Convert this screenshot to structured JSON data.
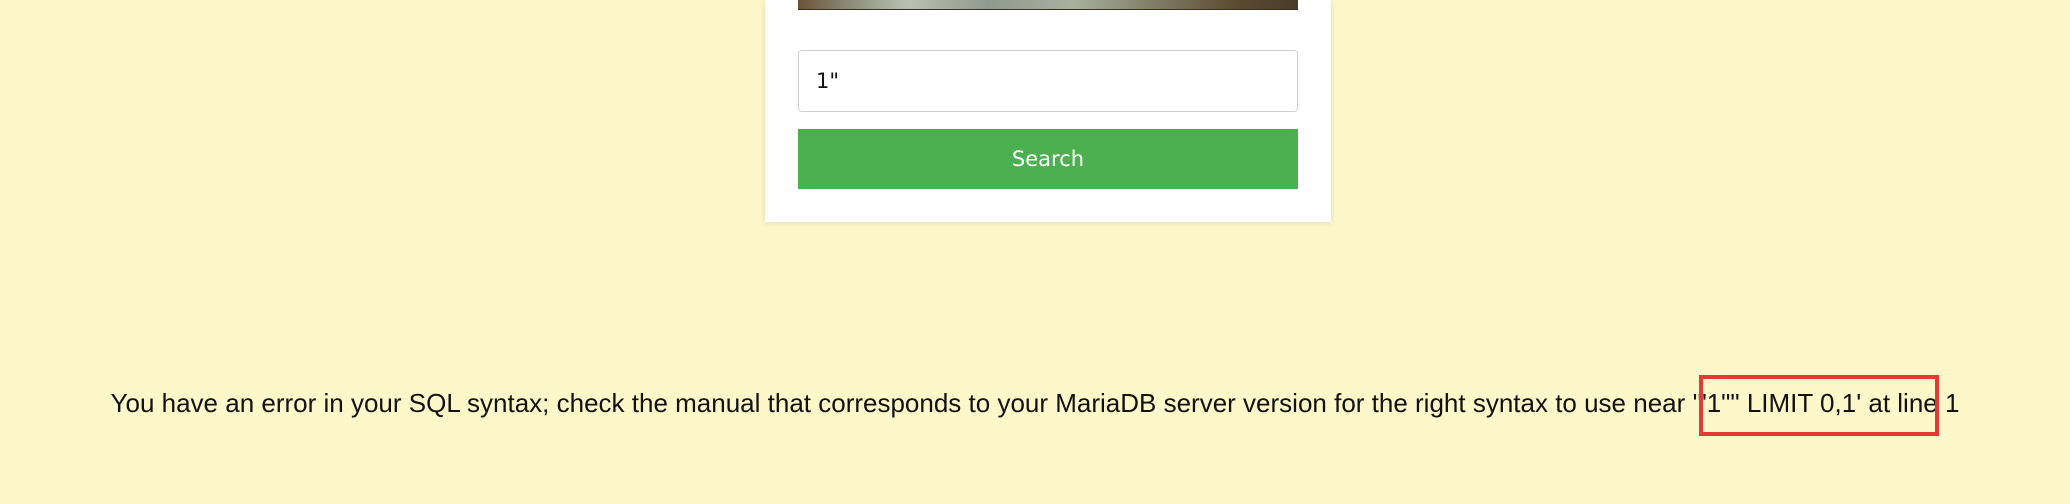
{
  "search": {
    "input_value": "1\"",
    "button_label": "Search"
  },
  "error": {
    "message": "You have an error in your SQL syntax; check the manual that corresponds to your MariaDB server version for the right syntax to use near '\"1\"\" LIMIT 0,1' at line 1"
  },
  "colors": {
    "page_background": "#fef7c9",
    "button_background": "#4caf50",
    "highlight_border": "#e53935"
  }
}
